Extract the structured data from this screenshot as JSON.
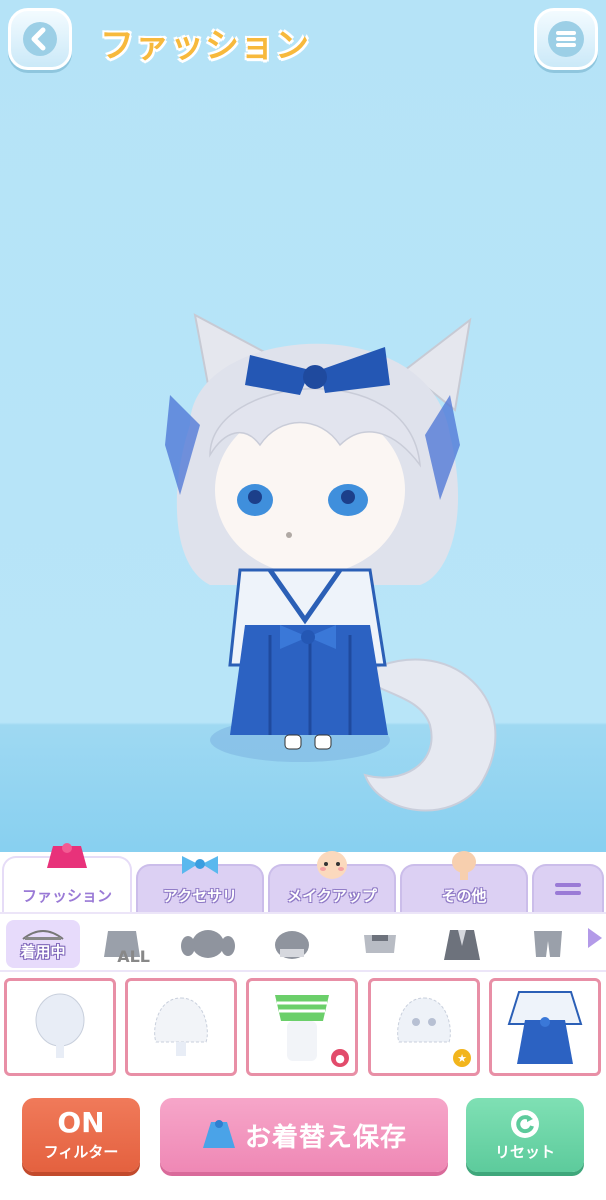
{
  "header": {
    "title": "ファッション",
    "back_icon": "chevron-left-icon",
    "menu_icon": "hamburger-menu-icon"
  },
  "tabs": [
    {
      "label": "ファッション",
      "icon": "dress-icon",
      "active": true
    },
    {
      "label": "アクセサリ",
      "icon": "ribbon-icon",
      "active": false
    },
    {
      "label": "メイクアップ",
      "icon": "face-icon",
      "active": false
    },
    {
      "label": "その他",
      "icon": "silhouette-icon",
      "active": false
    }
  ],
  "tab_more_icon": "equals-icon",
  "categories": {
    "in_use_label": "着用中",
    "all_label": "ALL",
    "items": [
      "hair-twintail-icon",
      "hair-short-icon",
      "top-icon",
      "jacket-icon",
      "pants-icon"
    ]
  },
  "items": [
    {
      "name": "face-blank-item"
    },
    {
      "name": "head-blank-item"
    },
    {
      "name": "striped-underwear-item",
      "badge": "pink-badge"
    },
    {
      "name": "cat-face-item",
      "badge": "star-badge"
    },
    {
      "name": "hakama-outfit-item"
    }
  ],
  "bottom": {
    "filter_state": "ON",
    "filter_label": "フィルター",
    "save_label": "お着替え保存",
    "reset_label": "リセット"
  },
  "colors": {
    "title": "#f7b93c",
    "tab_inactive": "#dcd0f3",
    "item_border": "#e88fa6",
    "filter": "#e4613f",
    "save": "#ef88b5",
    "reset": "#5dcb9c"
  }
}
